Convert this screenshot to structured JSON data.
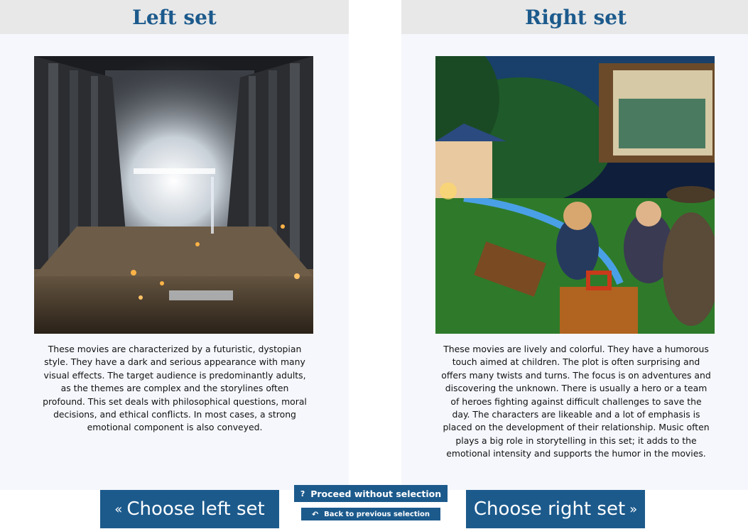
{
  "left": {
    "title": "Left set",
    "description": "These movies are characterized by a futuristic, dystopian style. They have a dark and serious appearance with many visual effects. The target audience is predominantly adults, as the themes are complex and the storylines often profound. This set deals with philosophical questions, moral decisions, and ethical conflicts. In most cases, a strong emotional component is also conveyed."
  },
  "right": {
    "title": "Right set",
    "description": "These movies are lively and colorful. They have a humorous touch aimed at children. The plot is often surprising and offers many twists and turns. The focus is on adventures and discovering the unknown. There is usually a hero or a team of heroes fighting against difficult challenges to save the day. The characters are likeable and a lot of emphasis is placed on the development of their relationship. Music often plays a big role in storytelling in this set; it adds to the emotional intensity and supports the humor in the movies."
  },
  "buttons": {
    "choose_left": "Choose left set",
    "choose_right": "Choose right set",
    "proceed": "Proceed without selection",
    "back": "Back to previous selection",
    "left_arrow": "«",
    "right_arrow": "»",
    "question_icon": "?",
    "back_icon": "↶"
  },
  "colors": {
    "accent": "#1c5a8c",
    "header_bg": "#e8e8e8",
    "panel_bg": "#f5f7fc"
  }
}
